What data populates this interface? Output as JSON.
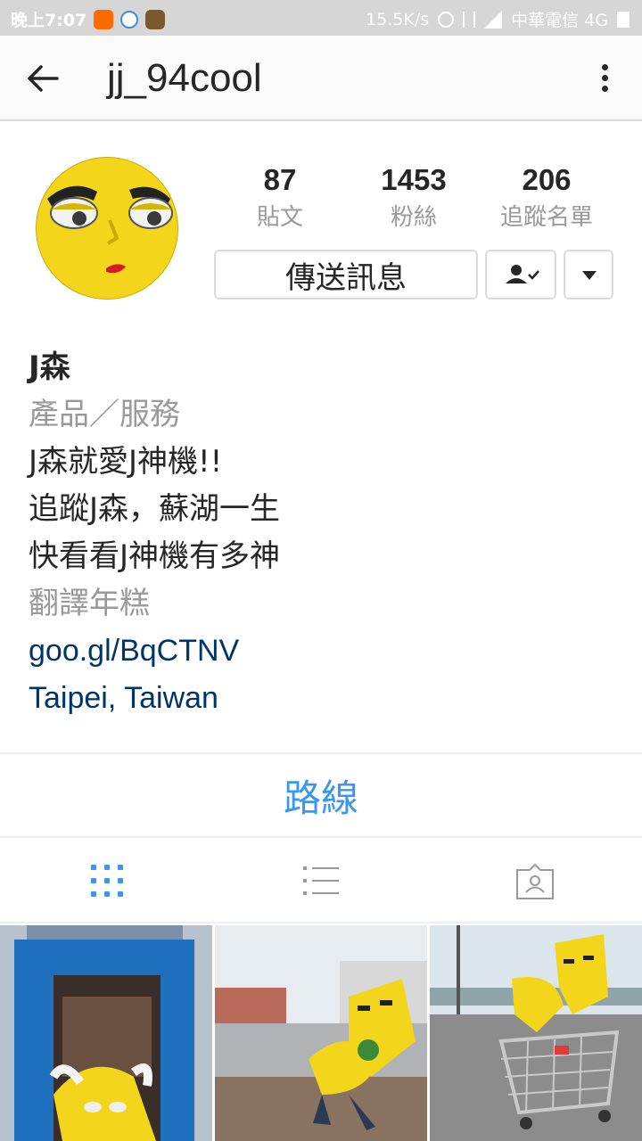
{
  "status_bar": {
    "time": "晚上7:07",
    "speed": "15.5K/s",
    "carrier": "中華電信 4G"
  },
  "header": {
    "username": "jj_94cool"
  },
  "stats": [
    {
      "value": "87",
      "label": "貼文"
    },
    {
      "value": "1453",
      "label": "粉絲"
    },
    {
      "value": "206",
      "label": "追蹤名單"
    }
  ],
  "actions": {
    "message_label": "傳送訊息"
  },
  "bio": {
    "name": "J森",
    "category": "產品／服務",
    "lines": [
      "J森就愛J神機!!",
      "追蹤J森，蘇湖一生",
      "快看看J神機有多神"
    ],
    "translate": "翻譯年糕",
    "link": "goo.gl/BqCTNV",
    "location": "Taipei, Taiwan"
  },
  "directions_label": "路線",
  "colors": {
    "accent": "#3897f0",
    "link": "#003569",
    "muted": "#999999",
    "avatar_yellow": "#f3d51b"
  }
}
